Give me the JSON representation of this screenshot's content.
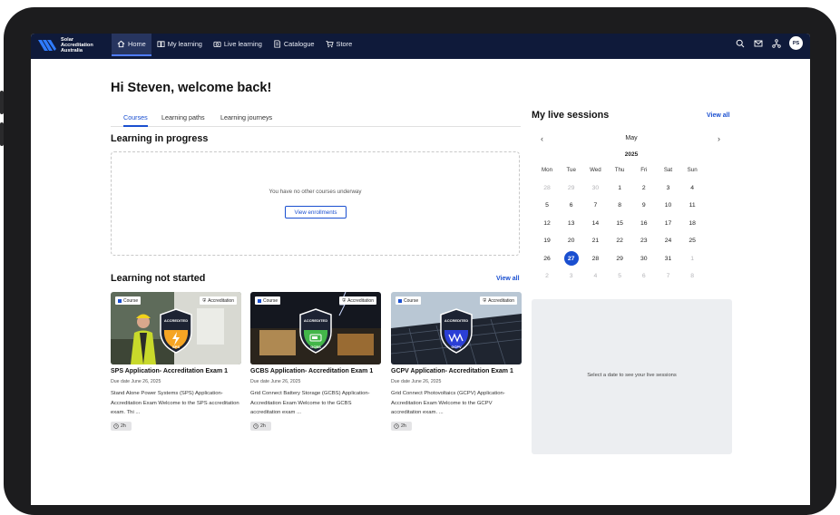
{
  "brand": {
    "name_line1": "Solar",
    "name_line2": "Accreditation",
    "name_line3": "Australia"
  },
  "nav": {
    "items": [
      {
        "label": "Home",
        "icon": "home-icon",
        "active": true
      },
      {
        "label": "My learning",
        "icon": "book-icon",
        "active": false
      },
      {
        "label": "Live learning",
        "icon": "camera-icon",
        "active": false
      },
      {
        "label": "Catalogue",
        "icon": "catalogue-icon",
        "active": false
      },
      {
        "label": "Store",
        "icon": "cart-icon",
        "active": false
      }
    ],
    "user_initials": "PS"
  },
  "main": {
    "welcome": "Hi Steven, welcome back!",
    "tabs": [
      "Courses",
      "Learning paths",
      "Learning journeys"
    ],
    "in_progress": {
      "title": "Learning in progress",
      "empty_text": "You have no other courses underway",
      "button": "View enrollments"
    },
    "not_started": {
      "title": "Learning not started",
      "view_all": "View all",
      "cards": [
        {
          "type_badge": "Course",
          "accred_badge": "Accreditation",
          "shield_label": "SPS",
          "shield_top": "ACCREDITED",
          "title": "SPS Application- Accreditation Exam 1",
          "due": "Due date June 26, 2025",
          "desc": "Stand Alone Power Systems (SPS) Application- Accreditation Exam   Welcome to the SPS accreditation exam. Thi ...",
          "duration": "2h",
          "accent": "#f5a524"
        },
        {
          "type_badge": "Course",
          "accred_badge": "Accreditation",
          "shield_label": "GCBS",
          "shield_top": "ACCREDITED",
          "title": "GCBS Application- Accreditation Exam 1",
          "due": "Due date June 26, 2025",
          "desc": "Grid Connect Battery Storage (GCBS) Application- Accreditation Exam   Welcome to the GCBS accreditation exam ...",
          "duration": "2h",
          "accent": "#43b649"
        },
        {
          "type_badge": "Course",
          "accred_badge": "Accreditation",
          "shield_label": "GCPV",
          "shield_top": "ACCREDITED",
          "title": "GCPV Application- Accreditation Exam 1",
          "due": "Due date June 26, 2025",
          "desc": "Grid Connect Photovoltaics (GCPV) Application- Accreditation Exam   Welcome to the GCPV accreditation exam. ...",
          "duration": "2h",
          "accent": "#2b3fd6"
        }
      ]
    }
  },
  "sessions": {
    "title": "My live sessions",
    "view_all": "View all",
    "month": "May",
    "year": "2025",
    "weekdays": [
      "Mon",
      "Tue",
      "Wed",
      "Thu",
      "Fri",
      "Sat",
      "Sun"
    ],
    "weeks": [
      [
        "28",
        "29",
        "30",
        "1",
        "2",
        "3",
        "4"
      ],
      [
        "5",
        "6",
        "7",
        "8",
        "9",
        "10",
        "11"
      ],
      [
        "12",
        "13",
        "14",
        "15",
        "16",
        "17",
        "18"
      ],
      [
        "19",
        "20",
        "21",
        "22",
        "23",
        "24",
        "25"
      ],
      [
        "26",
        "27",
        "28",
        "29",
        "30",
        "31",
        "1"
      ],
      [
        "2",
        "3",
        "4",
        "5",
        "6",
        "7",
        "8"
      ]
    ],
    "selected_day": "27",
    "empty_text": "Select a date to see your live sessions"
  },
  "colors": {
    "nav_bg": "#0f1a3a",
    "accent": "#1a4fd0"
  }
}
